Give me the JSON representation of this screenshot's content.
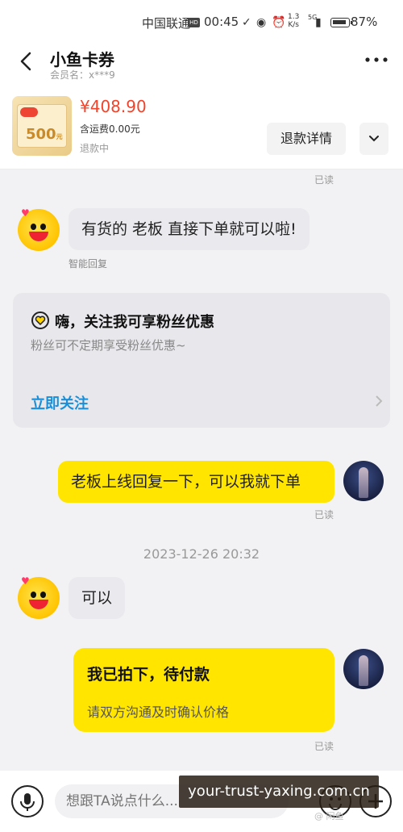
{
  "status_bar": {
    "carrier": "中国联通",
    "hd": "HD",
    "time": "00:45",
    "speed_value": "1.3",
    "speed_unit": "K/s",
    "network": "5G",
    "battery": "87%"
  },
  "header": {
    "shop_name": "小鱼卡券",
    "member_label": "会员名：x***9"
  },
  "order": {
    "coupon_value": "500",
    "coupon_unit": "元",
    "price": "¥408.90",
    "shipping": "含运费0.00元",
    "status": "退款中",
    "refund_button": "退款详情"
  },
  "messages": {
    "read_1": "已读",
    "bot_reply_1": "有货的 老板 直接下单就可以啦!",
    "auto_reply_label": "智能回复",
    "follow_title": "嗨，关注我可享粉丝优惠",
    "follow_sub": "粉丝可不定期享受粉丝优惠~",
    "follow_link": "立即关注",
    "user_msg_1": "老板上线回复一下，可以我就下单",
    "read_2": "已读",
    "timestamp": "2023-12-26 20:32",
    "bot_reply_2": "可以",
    "card_title": "我已拍下，待付款",
    "card_sub": "请双方沟通及时确认价格",
    "read_3": "已读"
  },
  "input": {
    "placeholder": "想跟TA说点什么..."
  },
  "overlay": {
    "watermark": "your-trust-yaxing.com.cn",
    "corner_mark": "@ 闲鱼"
  },
  "colors": {
    "accent_yellow": "#ffe500",
    "price_red": "#f0442c",
    "link_blue": "#1a8fd8"
  }
}
